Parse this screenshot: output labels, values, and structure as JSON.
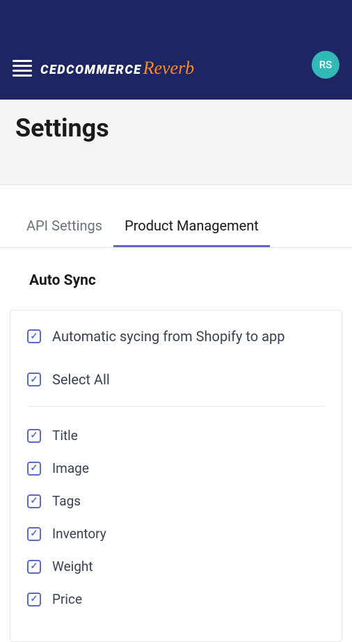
{
  "header": {
    "logo_ced": "CEDCOMMERCE",
    "logo_reverb": "Reverb",
    "avatar_initials": "RS"
  },
  "page": {
    "title": "Settings"
  },
  "tabs": {
    "api_settings": "API Settings",
    "product_management": "Product Management"
  },
  "section": {
    "title": "Auto Sync"
  },
  "checkboxes": {
    "auto_sync": "Automatic sycing from Shopify to app",
    "select_all": "Select All",
    "title": "Title",
    "image": "Image",
    "tags": "Tags",
    "inventory": "Inventory",
    "weight": "Weight",
    "price": "Price"
  }
}
